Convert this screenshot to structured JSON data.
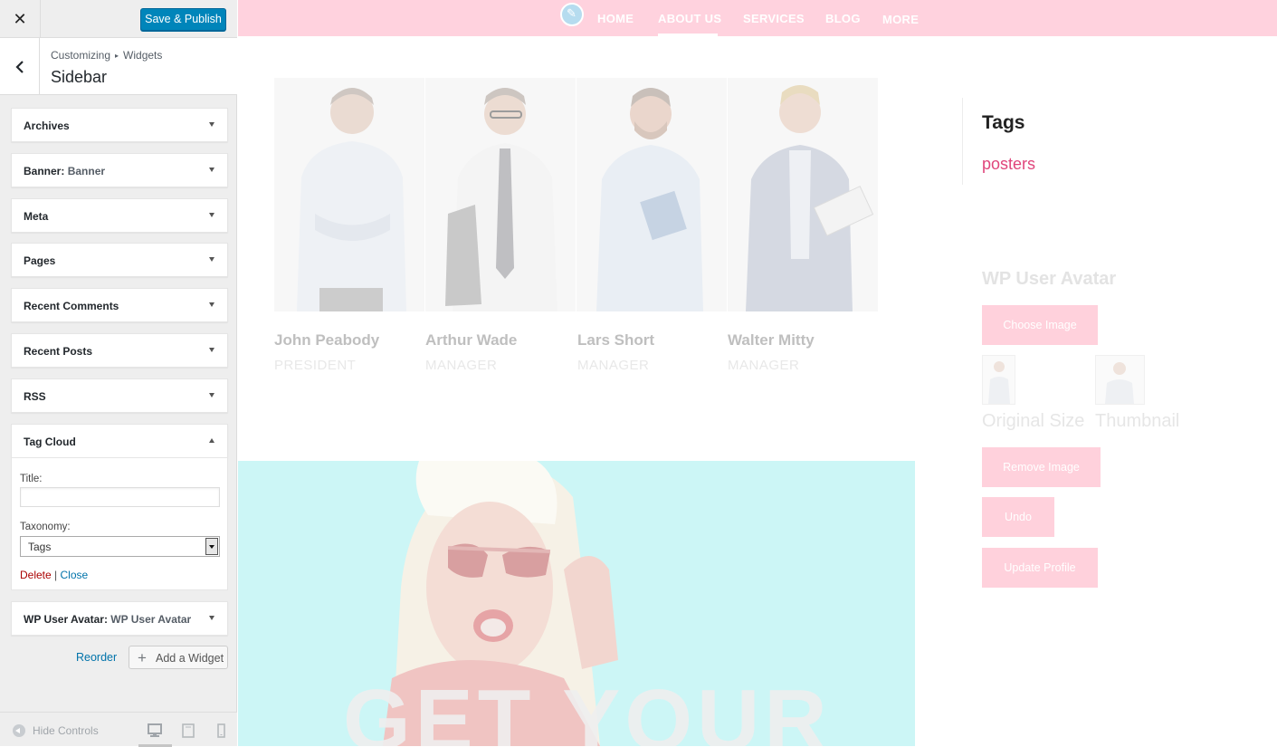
{
  "customizer": {
    "close_icon": "close-icon",
    "save_label": "Save & Publish",
    "breadcrumb": {
      "part1": "Customizing",
      "separator": "▸",
      "part2": "Widgets"
    },
    "section_title": "Sidebar",
    "widgets": [
      {
        "title": "Archives",
        "subtitle": ""
      },
      {
        "title": "Banner",
        "subtitle": "Banner"
      },
      {
        "title": "Meta",
        "subtitle": ""
      },
      {
        "title": "Pages",
        "subtitle": ""
      },
      {
        "title": "Recent Comments",
        "subtitle": ""
      },
      {
        "title": "Recent Posts",
        "subtitle": ""
      },
      {
        "title": "RSS",
        "subtitle": ""
      },
      {
        "title": "Tag Cloud",
        "subtitle": "",
        "expanded": true
      },
      {
        "title": "WP User Avatar",
        "subtitle": "WP User Avatar"
      }
    ],
    "tag_cloud_form": {
      "title_label": "Title:",
      "title_value": "",
      "taxonomy_label": "Taxonomy:",
      "taxonomy_value": "Tags",
      "delete_label": "Delete",
      "divider": "|",
      "close_label": "Close"
    },
    "reorder_label": "Reorder",
    "add_widget_label": "Add a Widget",
    "footer": {
      "hide_controls_label": "Hide Controls",
      "devices": [
        "desktop",
        "tablet",
        "mobile"
      ],
      "active_device": "desktop"
    },
    "colors": {
      "primary": "#0085ba",
      "link": "#0073aa",
      "delete": "#a00000"
    }
  },
  "preview": {
    "nav": {
      "items": [
        "HOME",
        "ABOUT US",
        "SERVICES",
        "BLOG",
        "MORE"
      ],
      "active": "ABOUT US"
    },
    "team": [
      {
        "name": "John Peabody",
        "role": "PRESIDENT"
      },
      {
        "name": "Arthur Wade",
        "role": "MANAGER"
      },
      {
        "name": "Lars Short",
        "role": "MANAGER"
      },
      {
        "name": "Walter Mitty",
        "role": "MANAGER"
      }
    ],
    "banner_text": "GET YOUR",
    "sidebar": {
      "tags_title": "Tags",
      "tag": "posters",
      "wpua_title": "WP User Avatar",
      "choose_image": "Choose Image",
      "original_size": "Original Size",
      "thumbnail": "Thumbnail",
      "remove_image": "Remove Image",
      "undo": "Undo",
      "update_profile": "Update Profile"
    },
    "colors": {
      "nav_bg": "#ffd2de",
      "tag_link": "#e0457b",
      "banner_bg": "#ccf6f6"
    }
  }
}
